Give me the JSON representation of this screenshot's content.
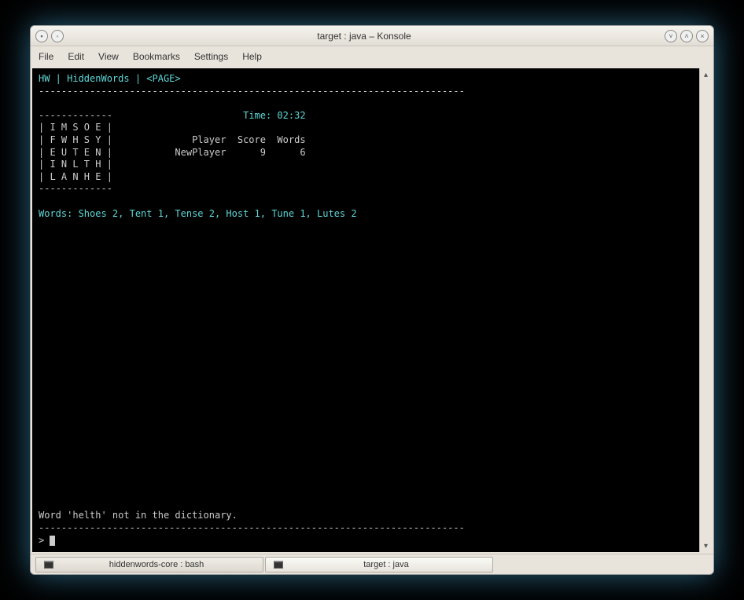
{
  "window": {
    "title": "target : java – Konsole"
  },
  "menubar": {
    "file": "File",
    "edit": "Edit",
    "view": "View",
    "bookmarks": "Bookmarks",
    "settings": "Settings",
    "help": "Help"
  },
  "terminal": {
    "header": "HW | HiddenWords | <PAGE>",
    "long_divider": "---------------------------------------------------------------------------",
    "short_divider": "-------------",
    "time_line": "                       Time: 02:32",
    "grid_rows": [
      "| I M S O E |",
      "| F W H S Y |              Player  Score  Words",
      "| E U T E N |           NewPlayer      9      6",
      "| I N L T H |",
      "| L A N H E |"
    ],
    "words_line": "Words: Shoes 2, Tent 1, Tense 2, Host 1, Tune 1, Lutes 2",
    "error_line": "Word 'helth' not in the dictionary.",
    "prompt": "> "
  },
  "tabs": [
    {
      "label": "hiddenwords-core : bash",
      "active": false
    },
    {
      "label": "target : java",
      "active": true
    }
  ]
}
